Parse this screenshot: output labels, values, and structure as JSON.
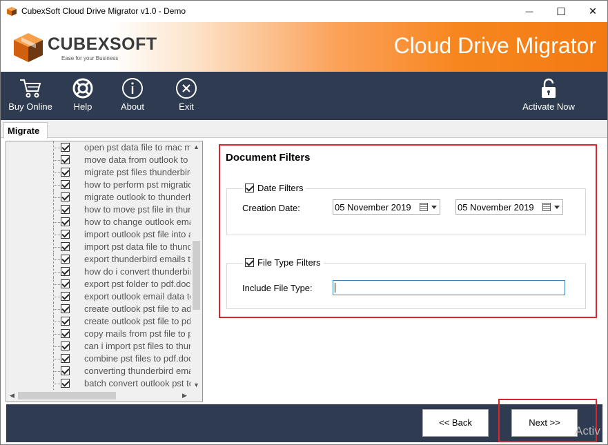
{
  "window": {
    "title": "CubexSoft Cloud Drive Migrator v1.0 - Demo",
    "minimize_glyph": "—",
    "maximize_glyph": "☐",
    "close_glyph": "✕"
  },
  "banner": {
    "logo_text": "CUBEXSOFT",
    "logo_tagline": "Ease for your Business",
    "product_title": "Cloud Drive Migrator"
  },
  "toolbar": {
    "buy_online": "Buy Online",
    "help": "Help",
    "about": "About",
    "exit": "Exit",
    "activate_now": "Activate Now"
  },
  "tabs": {
    "migrate": "Migrate"
  },
  "tree": {
    "items": [
      "open pst data file to mac mail",
      "move data from outlook to thunderbird",
      "migrate pst files thunderbird",
      "how to perform pst migration",
      "migrate outlook to thunderbird",
      "how to move pst file in thunderbird",
      "how to change outlook email",
      "import outlook pst file into apple",
      "import pst data file to thunderbird",
      "export thunderbird emails to pst",
      "how do i convert thunderbird",
      "export pst folder to pdf.docx",
      "export outlook email data to",
      "create outlook pst file to add",
      "create outlook pst file to pdf",
      "copy mails from pst file to pdf",
      "can i import pst files to thunderbird",
      "combine pst files to pdf.docx",
      "converting thunderbird emails",
      "batch convert outlook pst to"
    ],
    "scroll_up": "▲",
    "scroll_down": "▼",
    "scroll_left": "◀",
    "scroll_right": "▶"
  },
  "filters": {
    "heading": "Document Filters",
    "date_filters": {
      "label": "Date Filters",
      "checked": true,
      "creation_date_label": "Creation Date:",
      "from_date": "05 November 2019",
      "to_date": "05 November 2019"
    },
    "file_type_filters": {
      "label": "File Type Filters",
      "checked": true,
      "include_label": "Include File Type:",
      "include_value": ""
    }
  },
  "footer": {
    "back_label": "<< Back",
    "next_label": "Next >>"
  },
  "watermark": "Activ",
  "colors": {
    "toolbar_bg": "#2e3b50",
    "highlight_red": "#d9262b",
    "banner_orange": "#f37a12"
  }
}
